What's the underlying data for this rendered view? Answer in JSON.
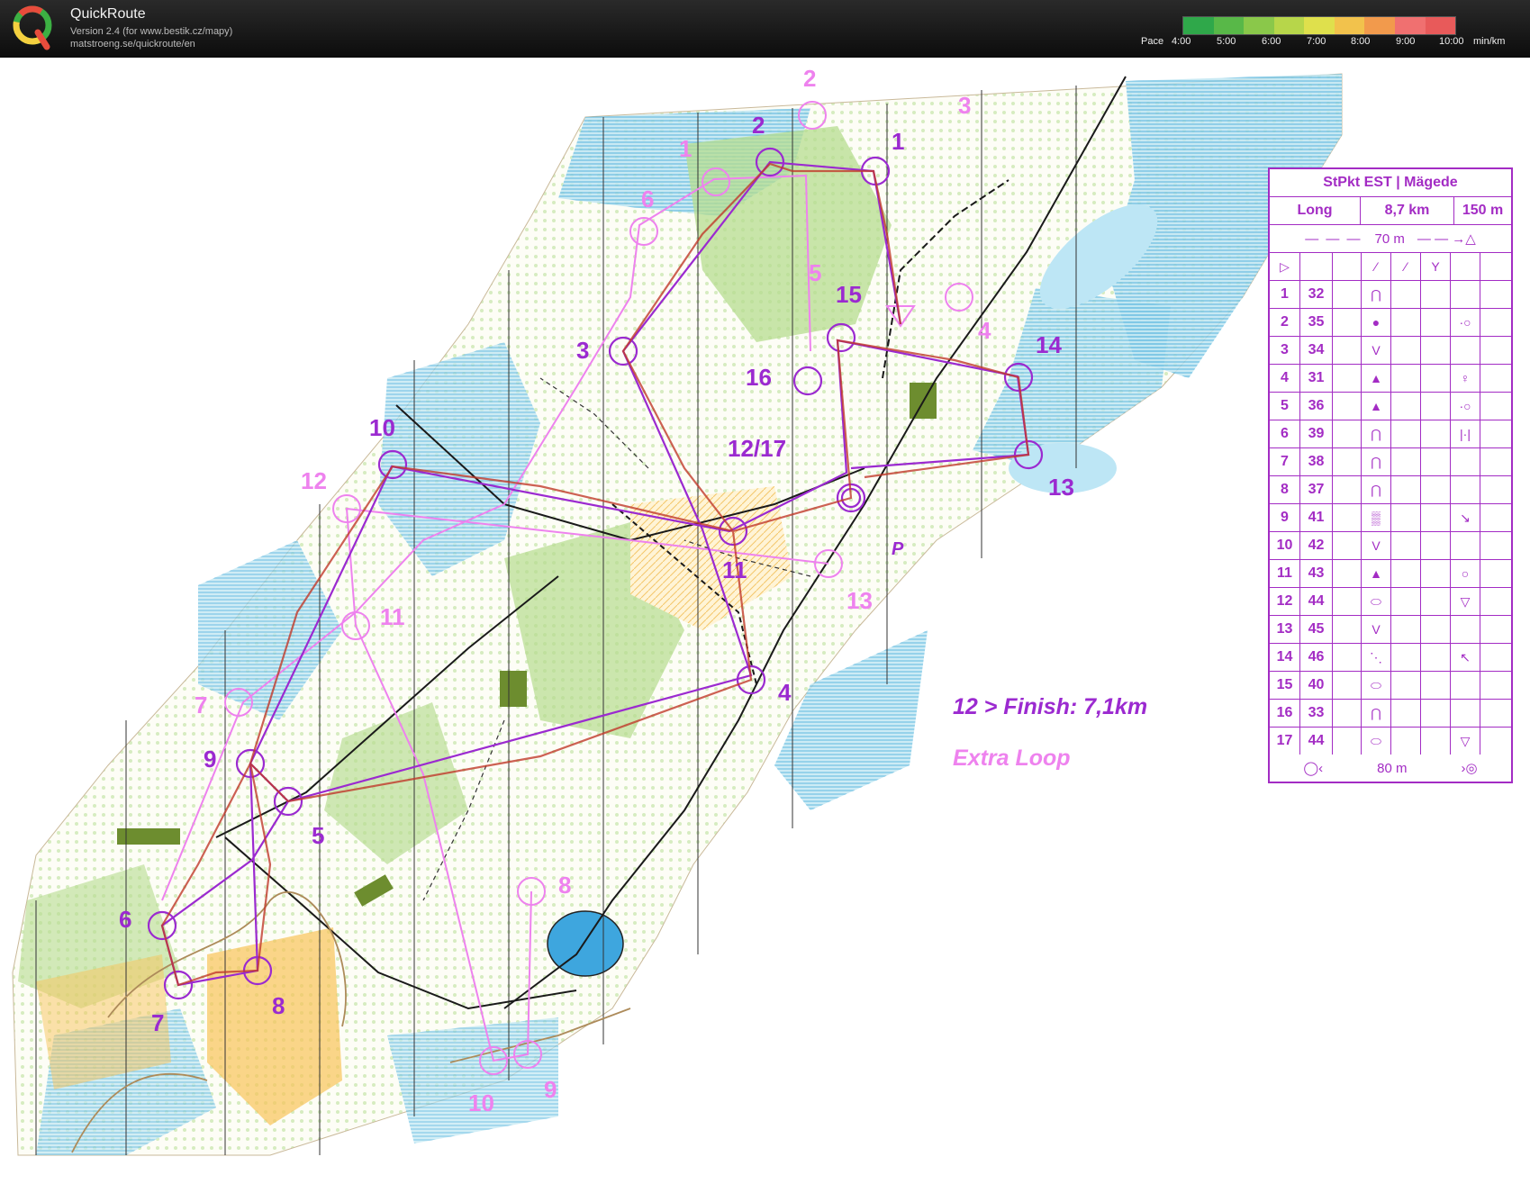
{
  "app": {
    "title": "QuickRoute",
    "version": "Version 2.4  (for www.bestik.cz/mapy)",
    "url": "matstroeng.se/quickroute/en"
  },
  "pace_scale": {
    "label": "Pace",
    "ticks": [
      "4:00",
      "5:00",
      "6:00",
      "7:00",
      "8:00",
      "9:00",
      "10:00"
    ],
    "unit": "min/km",
    "colors": [
      "#2fa84a",
      "#58b848",
      "#8ac84a",
      "#b7d64a",
      "#dfe04c",
      "#f2c24c",
      "#f29a4c",
      "#f07070",
      "#e85a5a"
    ]
  },
  "map_labels": {
    "main": [
      "1",
      "2",
      "3",
      "4",
      "5",
      "6",
      "7",
      "8",
      "9",
      "10",
      "11",
      "12/17",
      "13",
      "14",
      "15",
      "16"
    ],
    "extra": [
      "1",
      "2",
      "3",
      "4",
      "5",
      "6",
      "7",
      "8",
      "9",
      "10",
      "11",
      "12",
      "13"
    ],
    "parking": "P"
  },
  "colors": {
    "course_main": "#9b2ad0",
    "course_extra": "#ee82ee",
    "route": "#c0392b"
  },
  "legend": {
    "main": "12 > Finish: 7,1km",
    "extra": "Extra Loop"
  },
  "control_card": {
    "title": "StPkt EST | Mägede",
    "class": "Long",
    "length": "8,7 km",
    "climb": "150 m",
    "start_distance": "70 m",
    "finish_distance": "80 m",
    "controls": [
      {
        "num": "1",
        "code": "32",
        "symbol": "⋂",
        "extra": ""
      },
      {
        "num": "2",
        "code": "35",
        "symbol": "●",
        "extra": "·○"
      },
      {
        "num": "3",
        "code": "34",
        "symbol": "V",
        "extra": ""
      },
      {
        "num": "4",
        "code": "31",
        "symbol": "▲",
        "extra": "♀"
      },
      {
        "num": "5",
        "code": "36",
        "symbol": "▲",
        "extra": "·○"
      },
      {
        "num": "6",
        "code": "39",
        "symbol": "⋂",
        "extra": "|·|"
      },
      {
        "num": "7",
        "code": "38",
        "symbol": "⋂",
        "extra": ""
      },
      {
        "num": "8",
        "code": "37",
        "symbol": "⋂",
        "extra": ""
      },
      {
        "num": "9",
        "code": "41",
        "symbol": "▒",
        "extra": "↘"
      },
      {
        "num": "10",
        "code": "42",
        "symbol": "V",
        "extra": ""
      },
      {
        "num": "11",
        "code": "43",
        "symbol": "▲",
        "extra": "○"
      },
      {
        "num": "12",
        "code": "44",
        "symbol": "⬭",
        "extra": "▽"
      },
      {
        "num": "13",
        "code": "45",
        "symbol": "V",
        "extra": ""
      },
      {
        "num": "14",
        "code": "46",
        "symbol": "⋱",
        "extra": "↖"
      },
      {
        "num": "15",
        "code": "40",
        "symbol": "⬭",
        "extra": ""
      },
      {
        "num": "16",
        "code": "33",
        "symbol": "⋂",
        "extra": ""
      },
      {
        "num": "17",
        "code": "44",
        "symbol": "⬭",
        "extra": "▽"
      }
    ]
  }
}
